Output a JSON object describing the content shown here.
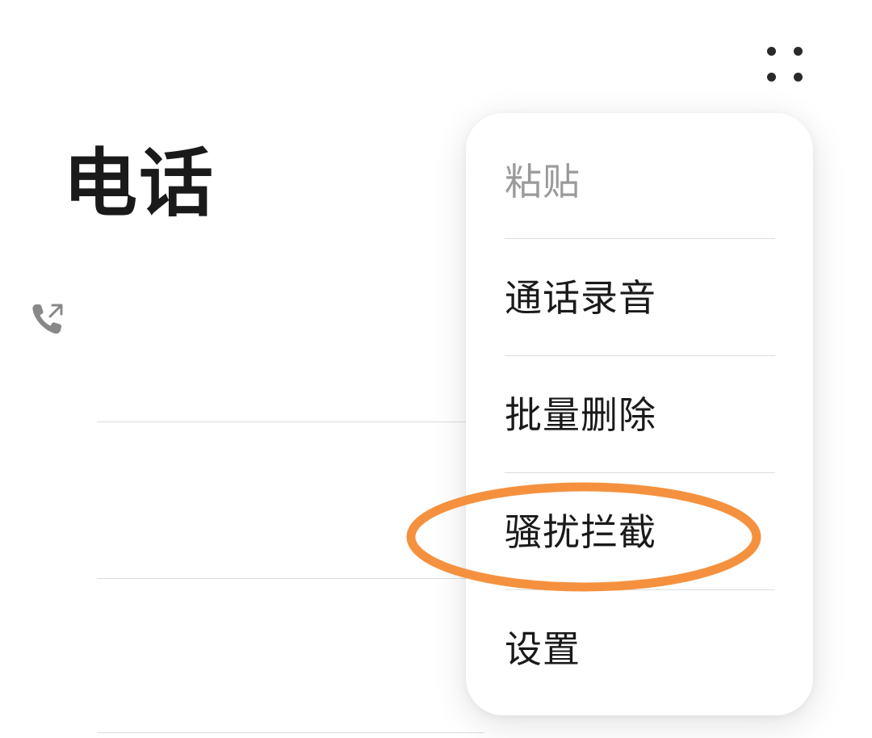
{
  "app": {
    "title": "电话"
  },
  "header": {
    "more_icon": "more-dots-icon"
  },
  "call_log": {
    "entries": [
      {
        "icon": "outgoing-call-icon"
      }
    ]
  },
  "overflow_menu": {
    "items": [
      {
        "label": "粘贴",
        "enabled": false
      },
      {
        "label": "通话录音",
        "enabled": true
      },
      {
        "label": "批量删除",
        "enabled": true
      },
      {
        "label": "骚扰拦截",
        "enabled": true,
        "highlighted": true
      },
      {
        "label": "设置",
        "enabled": true
      }
    ]
  },
  "colors": {
    "highlight": "#f5913e",
    "disabled_text": "#9a9a9a",
    "primary_text": "#1a1a1a"
  }
}
